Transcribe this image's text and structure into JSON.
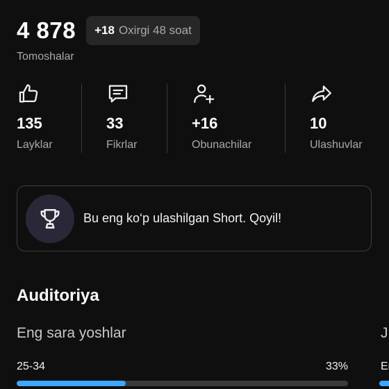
{
  "views": {
    "count": "4 878",
    "delta": "+18",
    "delta_period": "Oxirgi 48 soat",
    "label": "Tomoshalar"
  },
  "stats": [
    {
      "icon": "thumbs-up-icon",
      "value": "135",
      "label": "Layklar"
    },
    {
      "icon": "comment-icon",
      "value": "33",
      "label": "Fikrlar"
    },
    {
      "icon": "add-subscriber-icon",
      "value": "+16",
      "label": "Obunachilar"
    },
    {
      "icon": "share-icon",
      "value": "10",
      "label": "Ulashuvlar"
    }
  ],
  "achievement": {
    "icon": "trophy-icon",
    "text": "Bu eng ko‘p ulashilgan Short. Qoyil!"
  },
  "audience": {
    "title": "Auditoriya",
    "card_title": "Eng sara yoshlar",
    "next_card_title": "J",
    "top_age": {
      "range": "25-34",
      "percent": "33%",
      "fraction": 0.33
    },
    "next_card_item": "Er"
  },
  "colors": {
    "accent": "#3ea6ff",
    "background": "#0f0f0f",
    "trophy_bg": "#2a2838"
  }
}
